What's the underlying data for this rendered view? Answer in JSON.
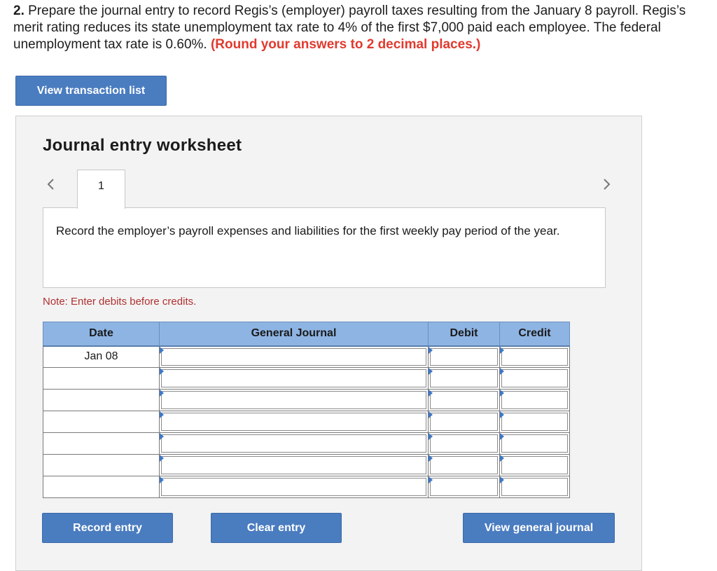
{
  "question": {
    "number": "2.",
    "text": " Prepare the journal entry to record Regis’s (employer) payroll taxes resulting from the January 8 payroll. Regis’s merit rating reduces its state unemployment tax rate to 4% of the first $7,000 paid each employee. The federal unemployment tax rate is 0.60%. ",
    "emphasis": "(Round your answers to 2 decimal places.)"
  },
  "buttons": {
    "view_transaction_list": "View transaction list",
    "record_entry": "Record entry",
    "clear_entry": "Clear entry",
    "view_general_journal": "View general journal"
  },
  "worksheet": {
    "title": "Journal entry worksheet",
    "tab_number": "1",
    "prompt": "Record the employer’s payroll expenses and liabilities for the first weekly pay period of the year.",
    "note": "Note: Enter debits before credits."
  },
  "journal": {
    "headers": {
      "date": "Date",
      "general_journal": "General Journal",
      "debit": "Debit",
      "credit": "Credit"
    },
    "rows": [
      {
        "date": "Jan 08",
        "account": "",
        "debit": "",
        "credit": ""
      },
      {
        "date": "",
        "account": "",
        "debit": "",
        "credit": ""
      },
      {
        "date": "",
        "account": "",
        "debit": "",
        "credit": ""
      },
      {
        "date": "",
        "account": "",
        "debit": "",
        "credit": ""
      },
      {
        "date": "",
        "account": "",
        "debit": "",
        "credit": ""
      },
      {
        "date": "",
        "account": "",
        "debit": "",
        "credit": ""
      },
      {
        "date": "",
        "account": "",
        "debit": "",
        "credit": ""
      }
    ]
  },
  "colors": {
    "button_blue": "#4a7cc0",
    "header_blue": "#8eb4e3",
    "emphasis_red": "#e03a2e",
    "note_red": "#b03030",
    "cell_marker": "#3d78c8"
  },
  "icons": {
    "prev": "chevron-left-icon",
    "next": "chevron-right-icon",
    "cell_marker": "triangle-marker-icon"
  }
}
